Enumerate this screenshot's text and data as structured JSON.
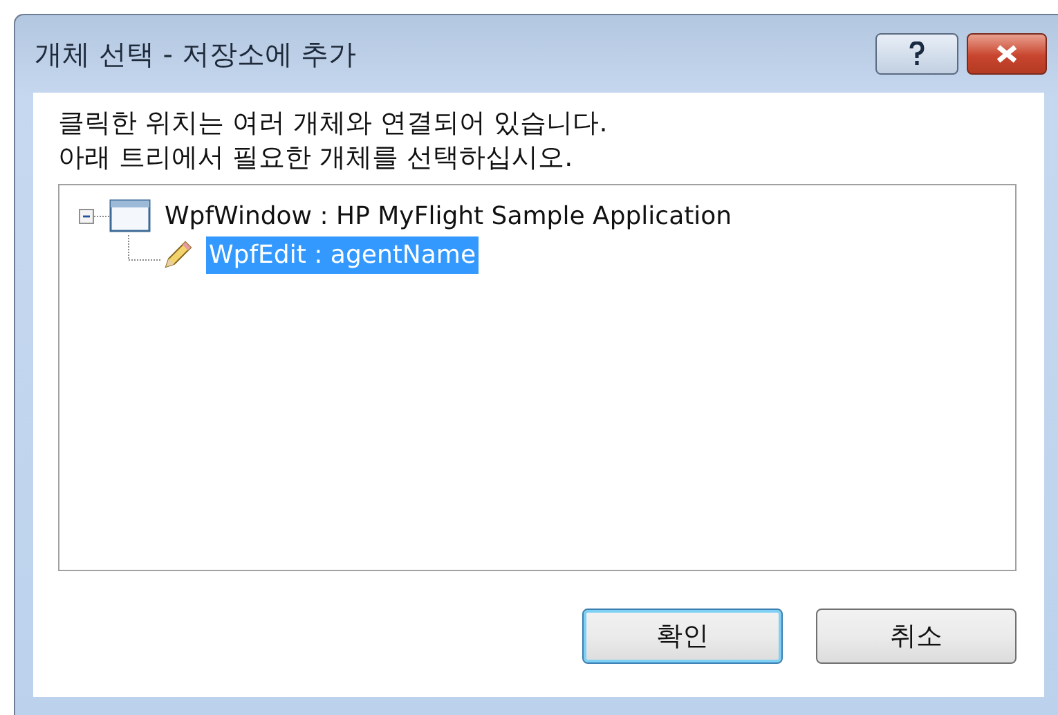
{
  "window": {
    "title": "개체 선택 - 저장소에 추가"
  },
  "message_lines": [
    "클릭한 위치는 여러 개체와 연결되어 있습니다.",
    "아래 트리에서 필요한 개체를 선택하십시오."
  ],
  "tree": [
    {
      "label": "WpfWindow : HP MyFlight Sample Application",
      "kind": "window",
      "expanded": true,
      "selected": false,
      "children": [
        {
          "label": "WpfEdit : agentName",
          "kind": "edit",
          "selected": true
        }
      ]
    }
  ],
  "buttons": [
    {
      "label": "확인",
      "default": true
    },
    {
      "label": "취소",
      "default": false
    }
  ]
}
